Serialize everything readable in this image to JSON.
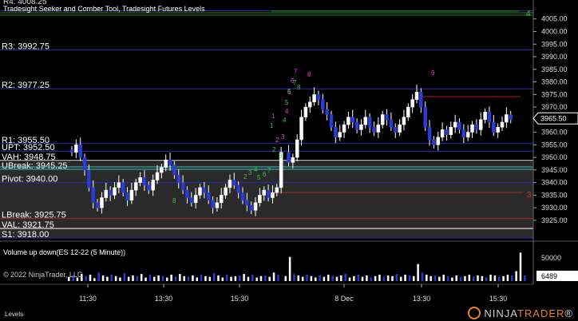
{
  "header": {
    "title": "Tradesight Seeker and Comber Tool, Tradesight Futures Levels"
  },
  "levels": [
    {
      "label": "R4: 4008.25",
      "value": 4008.25,
      "color": "#2d2db8",
      "show_label": true
    },
    {
      "label": "R3: 3992.75",
      "value": 3992.75,
      "color": "#2d2db8",
      "show_label": true
    },
    {
      "label": "R2: 3977.25",
      "value": 3977.25,
      "color": "#2d2db8",
      "show_label": true
    },
    {
      "label": "R1: 3955.50",
      "value": 3955.5,
      "color": "#2d2db8",
      "show_label": true
    },
    {
      "label": "UPT: 3952.50",
      "value": 3952.5,
      "color": "#2d2db8",
      "show_label": true
    },
    {
      "label": "VAH: 3948.75",
      "value": 3948.75,
      "color": "#ffffff",
      "show_label": true
    },
    {
      "label": "UBreak: 3945.25",
      "value": 3945.25,
      "color": "#b02020",
      "show_label": true
    },
    {
      "label": "Pivot: 3940.00",
      "value": 3940.0,
      "color": "#2d2db8",
      "show_label": true
    },
    {
      "label": "LBreak: 3925.75",
      "value": 3925.75,
      "color": "#b02020",
      "show_label": true
    },
    {
      "label": "VAL: 3921.75",
      "value": 3921.75,
      "color": "#ffffff",
      "show_label": true
    },
    {
      "label": "S1: 3918.00",
      "value": 3918.0,
      "color": "#2d2db8",
      "show_label": true
    }
  ],
  "price_axis": {
    "ticks": [
      "4005.00",
      "4000.00",
      "3995.00",
      "3990.00",
      "3985.00",
      "3980.00",
      "3975.00",
      "3970.00",
      "3965.00",
      "3960.00",
      "3955.00",
      "3950.00",
      "3945.00",
      "3940.00",
      "3935.00",
      "3930.00",
      "3925.00"
    ],
    "last_price": "3965.50"
  },
  "volume_panel": {
    "title": "Volume up down(ES 12-22 (5 Minute))",
    "axis_tick": "50000",
    "last_volume": "6489",
    "copyright": "© 2022 NinjaTrader, LLC",
    "bars": [
      6,
      8,
      5,
      10,
      7,
      9,
      4,
      12,
      8,
      6,
      9,
      7,
      5,
      11,
      6,
      8,
      7,
      10,
      5,
      9,
      6,
      8,
      7,
      5,
      9,
      6,
      10,
      7,
      6,
      8,
      5,
      9,
      7,
      6,
      11,
      8,
      5,
      9,
      6,
      7,
      8,
      10,
      6,
      9,
      5,
      7,
      8,
      6,
      12,
      9,
      7,
      34,
      10,
      8,
      6,
      9,
      7,
      5,
      8,
      6,
      9,
      7,
      6,
      8,
      10,
      5,
      7,
      9,
      6,
      8,
      5,
      7,
      9,
      6,
      8,
      7,
      10,
      6,
      9,
      8,
      7,
      24,
      12,
      9,
      7,
      8,
      6,
      9,
      7,
      5,
      8,
      6,
      7,
      9,
      6,
      8,
      7,
      5,
      9,
      8,
      6,
      7,
      9,
      8,
      14,
      40,
      8
    ]
  },
  "time_axis": {
    "labels": [
      "11:30",
      "13:30",
      "15:30",
      "8 Dec",
      "13:30",
      "15:30"
    ]
  },
  "annotations": {
    "upper_right_marker": "4",
    "red_marker": "3",
    "magenta_numbers": [
      "1",
      "2",
      "3",
      "4",
      "5",
      "6",
      "7",
      "8",
      "9"
    ],
    "green_numbers": [
      "1",
      "2",
      "3",
      "4",
      "5",
      "6",
      "7",
      "8",
      "2",
      "3",
      "4",
      "5",
      "6",
      "7",
      "8"
    ]
  },
  "bottom": {
    "tab": "Levels",
    "logo_main": "NINJA",
    "logo_accent": "TRADER",
    "logo_reg": "®"
  },
  "chart_data": {
    "type": "candlestick",
    "series_name": "ES 12-22 (5 Minute)",
    "ylim": [
      3918,
      4012
    ],
    "closes": [
      3952,
      3955,
      3950,
      3945,
      3938,
      3932,
      3930,
      3934,
      3937,
      3935,
      3938,
      3940,
      3936,
      3933,
      3937,
      3940,
      3942,
      3939,
      3937,
      3941,
      3944,
      3946,
      3949,
      3947,
      3943,
      3940,
      3937,
      3934,
      3932,
      3935,
      3938,
      3936,
      3933,
      3930,
      3932,
      3935,
      3938,
      3941,
      3939,
      3936,
      3933,
      3931,
      3929,
      3932,
      3935,
      3937,
      3934,
      3936,
      3938,
      3952,
      3948,
      3950,
      3957,
      3966,
      3970,
      3972,
      3975,
      3973,
      3969,
      3967,
      3962,
      3958,
      3960,
      3963,
      3966,
      3964,
      3961,
      3963,
      3966,
      3962,
      3960,
      3963,
      3967,
      3965,
      3962,
      3960,
      3963,
      3966,
      3970,
      3973,
      3976,
      3970,
      3962,
      3957,
      3955,
      3958,
      3961,
      3959,
      3962,
      3964,
      3961,
      3958,
      3960,
      3963,
      3961,
      3965,
      3968,
      3964,
      3960,
      3962,
      3964,
      3967,
      3965
    ],
    "vertical_separator_value": "8 Dec"
  }
}
